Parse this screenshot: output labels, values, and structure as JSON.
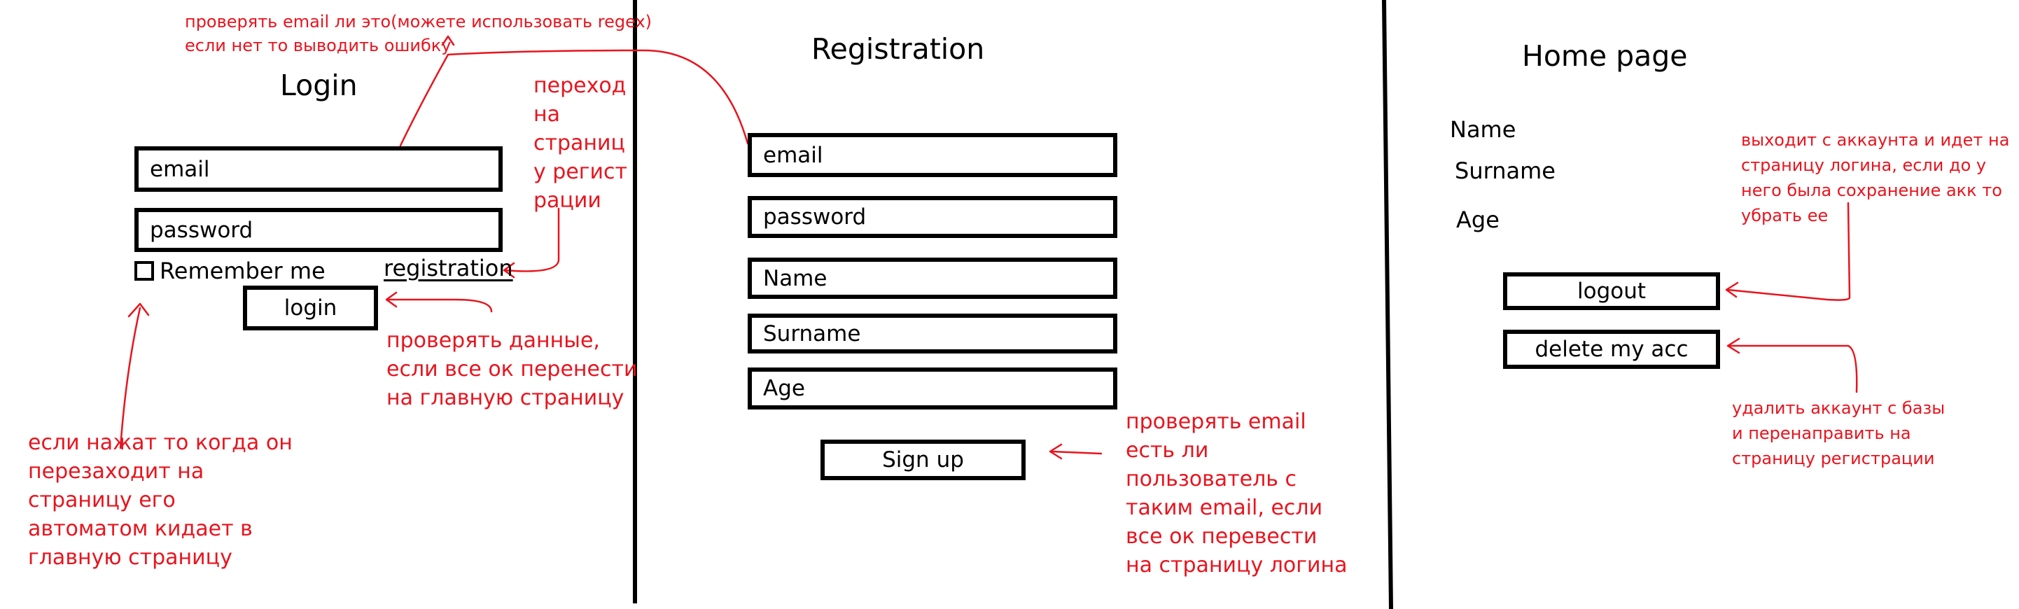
{
  "login": {
    "title": "Login",
    "email": "email",
    "password": "password",
    "remember_me": "Remember me",
    "registration_link": "registration",
    "login_button": "login"
  },
  "registration": {
    "title": "Registration",
    "email": "email",
    "password": "password",
    "name": "Name",
    "surname": "Surname",
    "age": "Age",
    "signup_button": "Sign up"
  },
  "home": {
    "title": "Home page",
    "name": "Name",
    "surname": "Surname",
    "age": "Age",
    "logout_button": "logout",
    "delete_button": "delete my acc"
  },
  "notes": {
    "email_check": "проверять email ли это(можете использовать regex)\nесли нет то выводить ошибку",
    "goto_registration": "переход\nна\nстраниц\nу регист\nрации",
    "check_login_data": "проверять данные,\nесли все ок перенести\nна главную страницу",
    "remember_me_note": "если нажат то когда он\nперезаходит на\nстраницу его\nавтоматом кидает в\nглавную страницу",
    "check_email_exists": "проверять email\nесть ли\nпользователь с\nтаким email, если\nвсе ок перевести\nна страницу логина",
    "logout_note": "выходит с аккаунта и идет на\nстраницу логина, если до у\nнего была сохранение акк то\nубрать ее",
    "delete_note": "удалить аккаунт с базы\nи перенаправить на\nстраницу регистрации"
  },
  "colors": {
    "ink": "#000000",
    "annotation": "#e8141e"
  }
}
